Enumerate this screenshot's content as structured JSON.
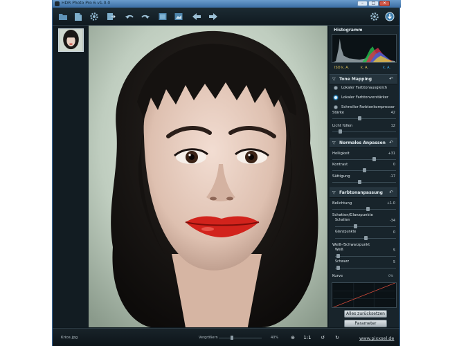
{
  "window": {
    "title": "HDR Photo Pro 6 v1.0.0"
  },
  "toolbar": {
    "buttons": [
      {
        "name": "folder-icon"
      },
      {
        "name": "open-icon"
      },
      {
        "name": "settings-gear-icon"
      },
      {
        "name": "export-icon"
      },
      {
        "name": "undo-icon"
      },
      {
        "name": "redo-icon"
      },
      {
        "name": "image-view-icon"
      },
      {
        "name": "compare-view-icon"
      },
      {
        "name": "arrow-left-icon"
      },
      {
        "name": "arrow-right-icon"
      },
      {
        "name": "gear-icon"
      },
      {
        "name": "download-icon"
      }
    ]
  },
  "histogram": {
    "title": "Histogramm",
    "labels": [
      "ISO k. A.",
      "k. A.",
      "k. A."
    ]
  },
  "sections": {
    "tone_mapping": {
      "title": "Tone Mapping",
      "options": [
        "Lokaler Farbtonausgleich",
        "Lokaler Farbtonverstärker",
        "Schneller Farbtonkompressor"
      ],
      "selected_index": 1,
      "sliders": [
        {
          "label": "Stärke",
          "value": "42",
          "level": 0.42
        },
        {
          "label": "Licht füllen",
          "value": "12",
          "level": 0.12
        }
      ]
    },
    "normal_adjust": {
      "title": "Normales Anpassen",
      "sliders": [
        {
          "label": "Helligkeit",
          "value": "+31",
          "level": 0.65
        },
        {
          "label": "Kontrast",
          "value": "0",
          "level": 0.5
        },
        {
          "label": "Sättigung",
          "value": "-17",
          "level": 0.42
        }
      ]
    },
    "tone_adjust": {
      "title": "Farbtonanpassung",
      "exposure": {
        "label": "Belichtung",
        "value": "+1.0",
        "level": 0.55
      },
      "shadows_highlights_title": "Schatten/Glanzpunkte",
      "shadows": {
        "label": "Schatten",
        "value": "-34",
        "level": 0.33
      },
      "highlights": {
        "label": "Glanzpunkte",
        "value": "0",
        "level": 0.5
      },
      "white_black_title": "Weiß-/Schwarzpunkt",
      "white": {
        "label": "Weiß",
        "value": "5",
        "level": 0.05
      },
      "black": {
        "label": "Schwarz",
        "value": "5",
        "level": 0.05
      },
      "curve_title": "Kurve",
      "curve_max": "0%"
    }
  },
  "buttons": {
    "reset_all": "Alles zurücksetzen",
    "parameters": "Parameter"
  },
  "status": {
    "filename": "Krice.jpg",
    "zoom_label": "Vergrößern",
    "zoom_value": "40%",
    "fit_label": "1:1",
    "website": "www.pixxsel.de"
  },
  "colors": {
    "accent": "#39a5e6",
    "panel_bg": "#18242b",
    "app_bg": "#0f1a20"
  }
}
